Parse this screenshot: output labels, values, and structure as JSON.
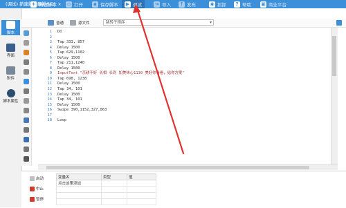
{
  "window": {
    "title": "(调试) 新建脚本(2)",
    "tab_label": "新建脚本(2)",
    "tab_close": "×"
  },
  "toolbar": {
    "items": [
      {
        "label": "新建脚本",
        "icon": "plus-icon"
      },
      {
        "label": "打开",
        "icon": "folder-icon"
      },
      {
        "label": "保存脚本",
        "icon": "save-icon"
      },
      {
        "label": "调试",
        "icon": "play-icon"
      },
      {
        "label": "导入",
        "icon": "import-icon"
      },
      {
        "label": "发布",
        "icon": "publish-icon"
      },
      {
        "label": "抓抓",
        "icon": "camera-icon"
      },
      {
        "label": "帮助",
        "icon": "help-icon"
      },
      {
        "label": "商业平台",
        "icon": "shop-icon"
      }
    ]
  },
  "sidebar": {
    "items": [
      {
        "label": "脚本",
        "icon": "script-icon"
      },
      {
        "label": "界面",
        "icon": "layout-icon"
      },
      {
        "label": "附件",
        "icon": "attachment-icon"
      },
      {
        "label": "脚本属性",
        "icon": "info-icon"
      }
    ]
  },
  "editbar": {
    "normal_label": "普通",
    "source_label": "源文件",
    "select_value": "跳转子程序"
  },
  "editor": {
    "lines": [
      "Do",
      "",
      "Tap 333, 857",
      "Delay 1500",
      "Tap 629,1102",
      "Delay 1500",
      "Tap 211,1240",
      "Delay 1500",
      "InputText \"京耕不好 长相 长到 加美味心1130 美好你看看，给你方案\"",
      "Tap 698, 1238",
      "Delay 1500",
      "Tap 34, 101",
      "Delay 1500",
      "Tap 34, 101",
      "Delay 1500",
      "Swipe 390,1152,327,863",
      "",
      "Loop"
    ]
  },
  "bottom": {
    "run_buttons": [
      {
        "label": "启动",
        "icon": "start-icon"
      },
      {
        "label": "中止",
        "icon": "stop-icon"
      },
      {
        "label": "暂停",
        "icon": "pause-icon"
      }
    ],
    "variables": {
      "columns": [
        "变量名",
        "类型",
        "值"
      ],
      "rows": [
        [
          "点击这里添加",
          "",
          ""
        ]
      ]
    }
  },
  "colors": {
    "accent": "#3c8fd9",
    "annotation": "#e0322f"
  }
}
